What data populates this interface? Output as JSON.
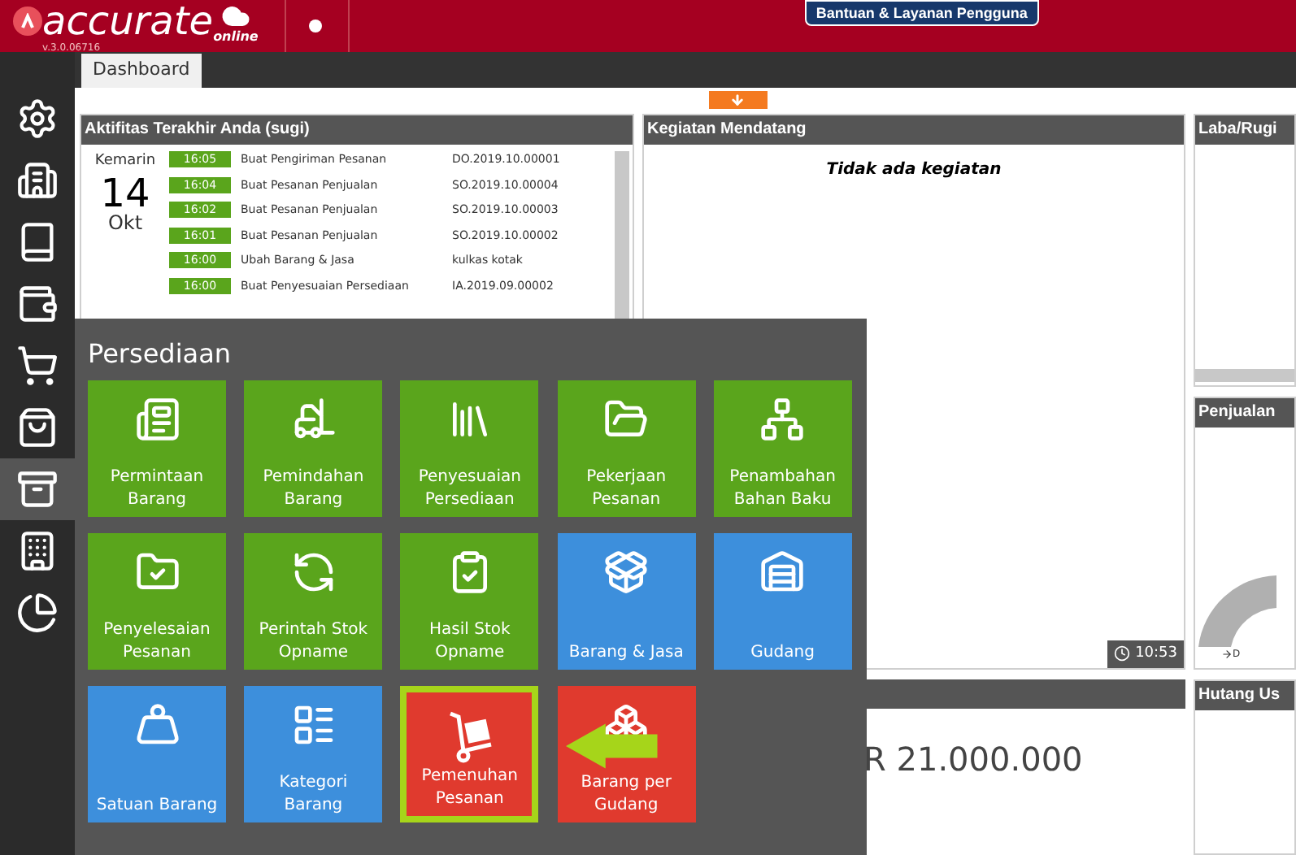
{
  "header": {
    "logo": "accurate",
    "logo_sub": "online",
    "version": "v.3.0.06716",
    "help_button": "Bantuan & Layanan Pengguna"
  },
  "sidebar": {
    "items": [
      {
        "selected": false
      },
      {
        "selected": false
      },
      {
        "selected": false
      },
      {
        "selected": false
      },
      {
        "selected": false
      },
      {
        "selected": false
      },
      {
        "selected": true
      },
      {
        "selected": false
      },
      {
        "selected": false
      }
    ]
  },
  "tabs": [
    {
      "label": "Dashboard",
      "selected": true
    }
  ],
  "recent_activity": {
    "title": "Aktifitas Terakhir Anda (sugi)",
    "day": "Kemarin",
    "date": "14",
    "month": "Okt",
    "rows": [
      {
        "time": "16:05",
        "action": "Buat Pengiriman Pesanan",
        "ref": "DO.2019.10.00001"
      },
      {
        "time": "16:04",
        "action": "Buat Pesanan Penjualan",
        "ref": "SO.2019.10.00004"
      },
      {
        "time": "16:02",
        "action": "Buat Pesanan Penjualan",
        "ref": "SO.2019.10.00003"
      },
      {
        "time": "16:01",
        "action": "Buat Pesanan Penjualan",
        "ref": "SO.2019.10.00002"
      },
      {
        "time": "16:00",
        "action": "Ubah Barang & Jasa",
        "ref": "kulkas kotak"
      },
      {
        "time": "16:00",
        "action": "Buat Penyesuaian Persediaan",
        "ref": "IA.2019.09.00002"
      }
    ]
  },
  "upcoming": {
    "title": "Kegiatan Mendatang",
    "empty_text": "Tidak ada kegiatan",
    "time": "10:53"
  },
  "lower_panel": {
    "amount": "R 21.000.000"
  },
  "right_panels": [
    {
      "title": "Laba/Rugi"
    },
    {
      "title": "Penjualan",
      "note": "D"
    },
    {
      "title": "Hutang Us"
    }
  ],
  "menu": {
    "title": "Persediaan",
    "tiles": [
      {
        "label": "Permintaan Barang",
        "color": "#5aa51c",
        "highlighted": false
      },
      {
        "label": "Pemindahan Barang",
        "color": "#5aa51c",
        "highlighted": false
      },
      {
        "label": "Penyesuaian Persediaan",
        "color": "#5aa51c",
        "highlighted": false
      },
      {
        "label": "Pekerjaan Pesanan",
        "color": "#5aa51c",
        "highlighted": false
      },
      {
        "label": "Penambahan Bahan Baku",
        "color": "#5aa51c",
        "highlighted": false
      },
      {
        "label": "Penyelesaian Pesanan",
        "color": "#5aa51c",
        "highlighted": false
      },
      {
        "label": "Perintah Stok Opname",
        "color": "#5aa51c",
        "highlighted": false
      },
      {
        "label": "Hasil Stok Opname",
        "color": "#5aa51c",
        "highlighted": false
      },
      {
        "label": "Barang & Jasa",
        "color": "#3d8fdc",
        "highlighted": false
      },
      {
        "label": "Gudang",
        "color": "#3d8fdc",
        "highlighted": false
      },
      {
        "label": "Satuan Barang",
        "color": "#3d8fdc",
        "highlighted": false
      },
      {
        "label": "Kategori Barang",
        "color": "#3d8fdc",
        "highlighted": false
      },
      {
        "label": "Pemenuhan Pesanan",
        "color": "#e03a2e",
        "highlighted": true
      },
      {
        "label": "Barang per Gudang",
        "color": "#e03a2e",
        "highlighted": false
      }
    ]
  }
}
